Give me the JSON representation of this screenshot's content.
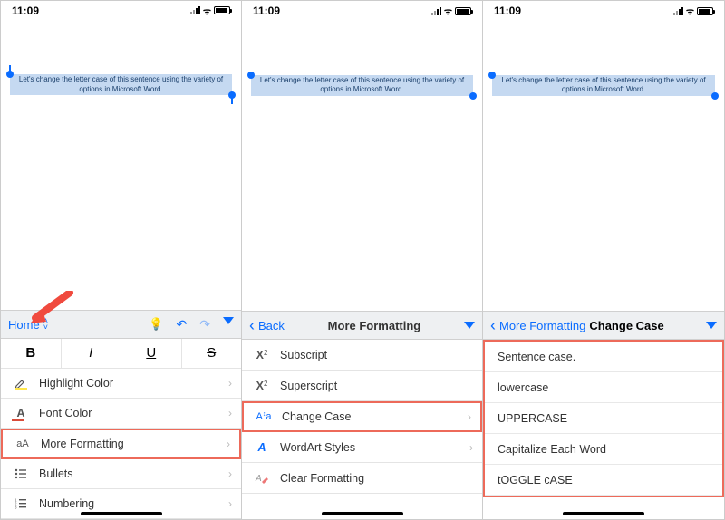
{
  "status": {
    "time": "11:09"
  },
  "doc_text": "Let's change the letter case of this sentence using the variety of options in Microsoft Word.",
  "pane1": {
    "toolbar_tab": "Home",
    "biu": {
      "b": "B",
      "i": "I",
      "u": "U",
      "s": "S"
    },
    "rows": {
      "highlight": "Highlight Color",
      "font_color": "Font Color",
      "more_formatting": "More Formatting",
      "bullets": "Bullets",
      "numbering": "Numbering"
    }
  },
  "pane2": {
    "back": "Back",
    "title": "More Formatting",
    "rows": {
      "subscript": "Subscript",
      "superscript": "Superscript",
      "change_case": "Change Case",
      "wordart": "WordArt Styles",
      "clear": "Clear Formatting"
    }
  },
  "pane3": {
    "back": "More Formatting",
    "title": "Change Case",
    "options": {
      "sentence": "Sentence case.",
      "lower": "lowercase",
      "upper": "UPPERCASE",
      "cap_each": "Capitalize Each Word",
      "toggle": "tOGGLE cASE"
    }
  }
}
